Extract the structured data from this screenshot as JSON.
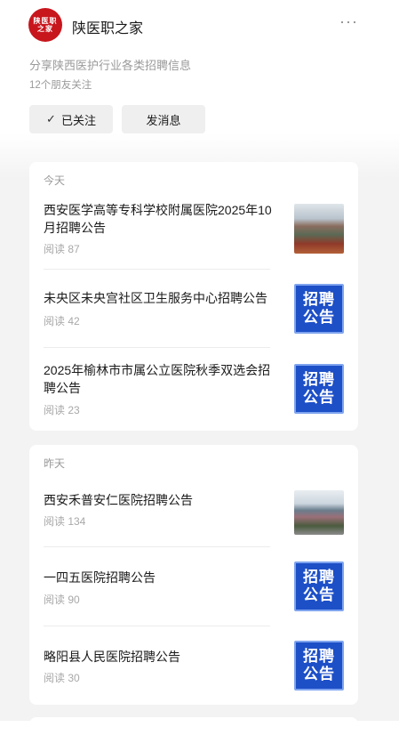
{
  "account": {
    "logo_text": [
      "陕医职",
      "之家"
    ],
    "name": "陕医职之家",
    "more_icon": "···",
    "description": "分享陕西医护行业各类招聘信息",
    "followers": "12个朋友关注",
    "follow_btn": "已关注",
    "follow_icon": "✓",
    "message_btn": "发消息"
  },
  "groups": [
    {
      "day": "今天",
      "items": [
        {
          "title": "西安医学高等专科学校附属医院2025年10月招聘公告",
          "reads": "阅读 87",
          "thumb": "photo"
        },
        {
          "title": "未央区未央宫社区卫生服务中心招聘公告",
          "reads": "阅读 42",
          "thumb": "notice",
          "thumb_text": [
            "招聘",
            "公告"
          ]
        },
        {
          "title": "2025年榆林市市属公立医院秋季双选会招聘公告",
          "reads": "阅读 23",
          "thumb": "notice",
          "thumb_text": [
            "招聘",
            "公告"
          ]
        }
      ]
    },
    {
      "day": "昨天",
      "items": [
        {
          "title": "西安禾普安仁医院招聘公告",
          "reads": "阅读 134",
          "thumb": "photo"
        },
        {
          "title": "一四五医院招聘公告",
          "reads": "阅读 90",
          "thumb": "notice",
          "thumb_text": [
            "招聘",
            "公告"
          ]
        },
        {
          "title": "略阳县人民医院招聘公告",
          "reads": "阅读 30",
          "thumb": "notice",
          "thumb_text": [
            "招聘",
            "公告"
          ]
        }
      ]
    }
  ]
}
